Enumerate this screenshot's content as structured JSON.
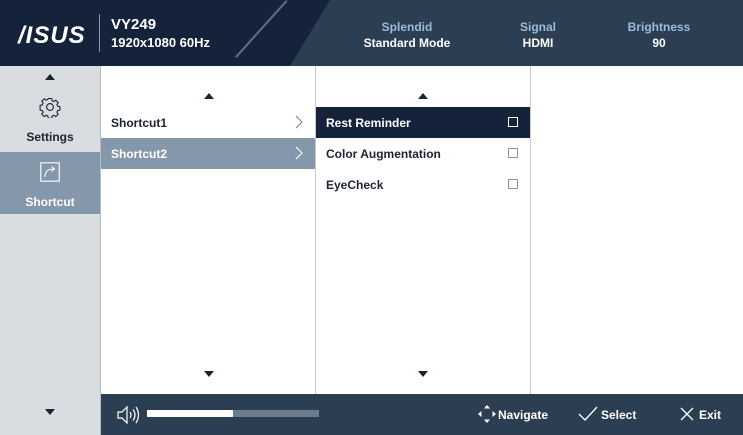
{
  "header": {
    "logo": "/ISUS",
    "model": "VY249",
    "resolution": "1920x1080 60Hz",
    "status": [
      {
        "label": "Splendid",
        "value": "Standard Mode"
      },
      {
        "label": "Signal",
        "value": "HDMI"
      },
      {
        "label": "Brightness",
        "value": "90"
      }
    ]
  },
  "categories": [
    {
      "label": "Settings",
      "icon": "gear-icon",
      "selected": false
    },
    {
      "label": "Shortcut",
      "icon": "shortcut-icon",
      "selected": true
    }
  ],
  "shortcuts": [
    {
      "label": "Shortcut1",
      "selected": false
    },
    {
      "label": "Shortcut2",
      "selected": true
    }
  ],
  "options": [
    {
      "label": "Rest Reminder",
      "checked": false,
      "selected": true
    },
    {
      "label": "Color Augmentation",
      "checked": false,
      "selected": false
    },
    {
      "label": "EyeCheck",
      "checked": false,
      "selected": false
    }
  ],
  "footer": {
    "volume_percent": 50,
    "navigate": "Navigate",
    "select": "Select",
    "exit": "Exit"
  },
  "colors": {
    "header_dark": "#14233a",
    "header_bg": "#2c3e52",
    "status_label": "#9bbbd8",
    "selection_gray": "#8597aa",
    "selection_dark": "#14233a",
    "side_panel": "#d9dde2"
  }
}
